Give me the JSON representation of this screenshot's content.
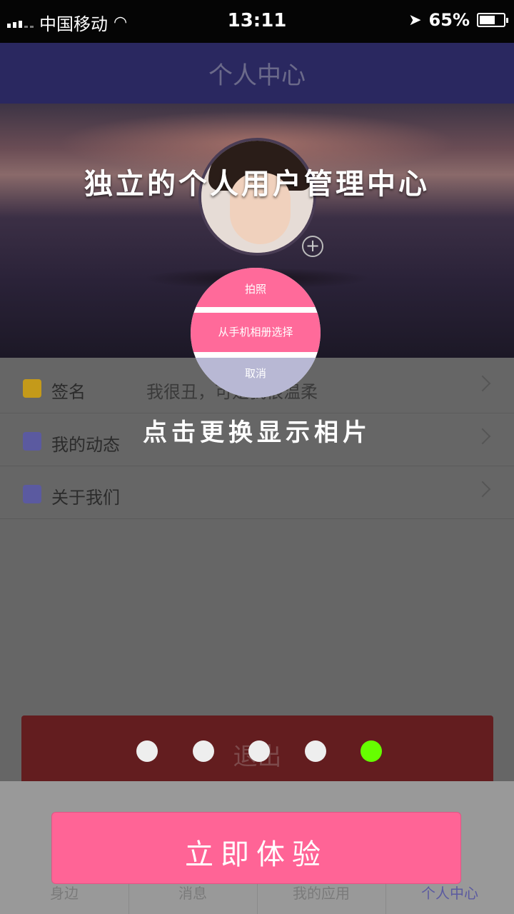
{
  "status_bar": {
    "carrier": "中国移动",
    "time": "13:11",
    "battery": "65%",
    "battery_level": 0.65
  },
  "header": {
    "title": "个人中心"
  },
  "banner": {
    "headline": "独立的个人用户管理中心",
    "add_icon": "+"
  },
  "action_sheet": {
    "take_photo": "拍照",
    "choose_album": "从手机相册选择",
    "cancel": "取消"
  },
  "list": [
    {
      "label": "签名",
      "value": "我很丑，可是我很温柔",
      "icon": "signature-icon",
      "color": "#c49a1a"
    },
    {
      "label": "我的动态",
      "value": "",
      "icon": "smile-icon",
      "color": "#5b5aa0"
    },
    {
      "label": "关于我们",
      "value": "",
      "icon": "person-icon",
      "color": "#5b5aa0"
    }
  ],
  "hint": "点击更换显示相片",
  "logout": {
    "label": "退出"
  },
  "pager": {
    "count": 5,
    "active_index": 4,
    "active_color": "#66ff00"
  },
  "tabs": [
    {
      "label": "身边"
    },
    {
      "label": "消息"
    },
    {
      "label": "我的应用"
    },
    {
      "label": "个人中心"
    }
  ],
  "cta": {
    "label": "立即体验"
  }
}
